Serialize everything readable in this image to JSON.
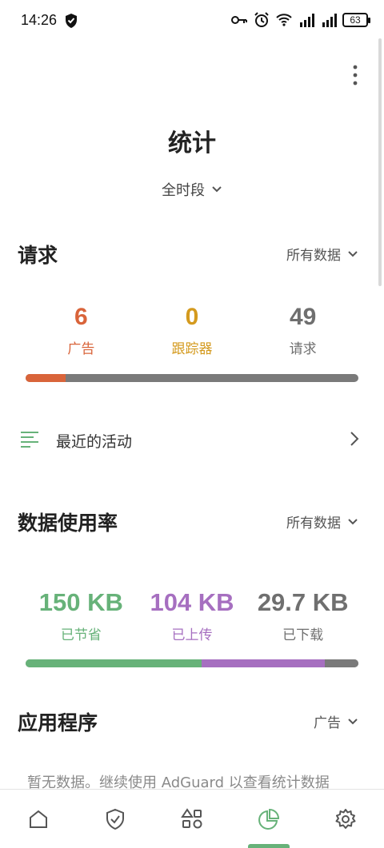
{
  "status_bar": {
    "time": "14:26",
    "battery": "63",
    "icons": [
      "key-icon",
      "alarm-icon",
      "wifi-icon",
      "signal-5g-icon",
      "signal-5g-icon"
    ]
  },
  "header": {
    "title": "统计",
    "period_label": "全时段",
    "menu_icon": "more-vert-icon"
  },
  "requests": {
    "title": "请求",
    "filter": "所有数据",
    "stats": [
      {
        "value": "6",
        "label": "广告",
        "color": "#d9643a"
      },
      {
        "value": "0",
        "label": "跟踪器",
        "color": "#d49a1e"
      },
      {
        "value": "49",
        "label": "请求",
        "color": "#6f6f6f"
      }
    ],
    "bar": {
      "ads_fraction": 0.12,
      "trackers_fraction": 0.0
    }
  },
  "activity": {
    "label": "最近的活动"
  },
  "data_usage": {
    "title": "数据使用率",
    "filter": "所有数据",
    "stats": [
      {
        "value": "150 KB",
        "label": "已节省",
        "color": "#67b279"
      },
      {
        "value": "104 KB",
        "label": "已上传",
        "color": "#a66fc0"
      },
      {
        "value": "29.7 KB",
        "label": "已下载",
        "color": "#6f6f6f"
      }
    ],
    "bar": {
      "saved_fraction": 0.53,
      "uploaded_fraction": 0.37,
      "downloaded_fraction": 0.1
    }
  },
  "apps": {
    "title": "应用程序",
    "filter": "广告",
    "empty_text": "暂无数据。继续使用 AdGuard 以查看统计数据"
  },
  "bottom_nav": {
    "items": [
      "home-icon",
      "protection-shield-icon",
      "apps-icon",
      "statistics-icon",
      "settings-icon"
    ],
    "active": "statistics-icon",
    "accent": "#67b279"
  }
}
